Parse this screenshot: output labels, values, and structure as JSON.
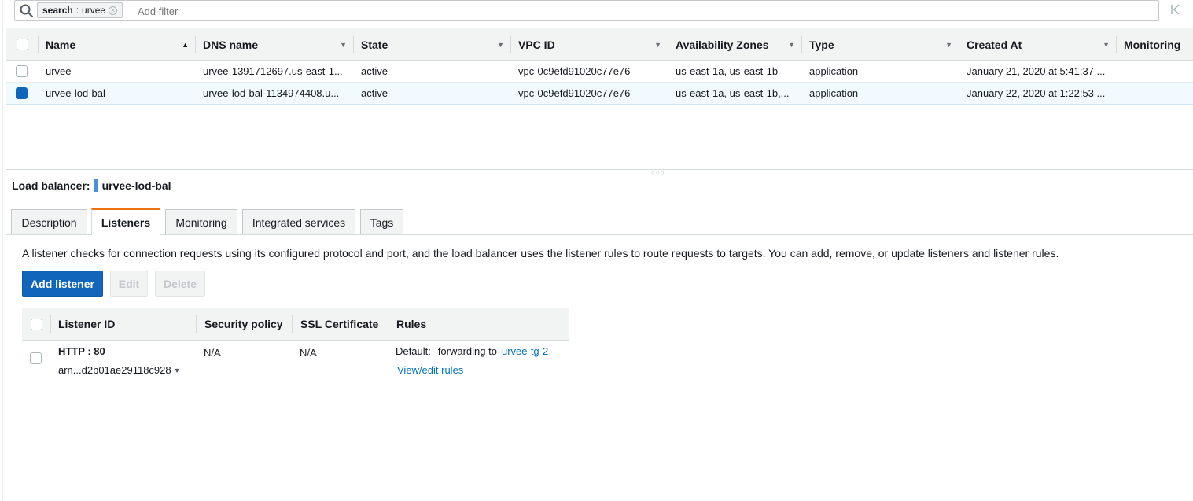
{
  "filter": {
    "token_key": "search",
    "token_sep": " : ",
    "token_value": "urvee",
    "placeholder": "Add filter"
  },
  "grid": {
    "columns": [
      {
        "label": "Name",
        "sort": "asc"
      },
      {
        "label": "DNS name"
      },
      {
        "label": "State"
      },
      {
        "label": "VPC ID"
      },
      {
        "label": "Availability Zones"
      },
      {
        "label": "Type"
      },
      {
        "label": "Created At"
      },
      {
        "label": "Monitoring"
      }
    ],
    "rows": [
      {
        "selected": false,
        "name": "urvee",
        "dns": "urvee-1391712697.us-east-1...",
        "state": "active",
        "vpc": "vpc-0c9efd91020c77e76",
        "az": "us-east-1a, us-east-1b",
        "type": "application",
        "created": "January 21, 2020 at 5:41:37 ..."
      },
      {
        "selected": true,
        "name": "urvee-lod-bal",
        "dns": "urvee-lod-bal-1134974408.u...",
        "state": "active",
        "vpc": "vpc-0c9efd91020c77e76",
        "az": "us-east-1a, us-east-1b,...",
        "type": "application",
        "created": "January 22, 2020 at 1:22:53 ..."
      }
    ]
  },
  "detail": {
    "label": "Load balancer:",
    "name": "urvee-lod-bal",
    "tabs": [
      "Description",
      "Listeners",
      "Monitoring",
      "Integrated services",
      "Tags"
    ],
    "active_tab": "Listeners",
    "description": "A listener checks for connection requests using its configured protocol and port, and the load balancer uses the listener rules to route requests to targets. You can add, remove, or update listeners and listener rules.",
    "buttons": {
      "add": "Add listener",
      "edit": "Edit",
      "delete": "Delete"
    },
    "listeners": {
      "columns": [
        "Listener ID",
        "Security policy",
        "SSL Certificate",
        "Rules"
      ],
      "rows": [
        {
          "id": "HTTP : 80",
          "arn": "arn...d2b01ae29118c928",
          "security_policy": "N/A",
          "ssl_certificate": "N/A",
          "rule_prefix": "Default:",
          "rule_action": "forwarding to",
          "rule_target": "urvee-tg-2",
          "rule_link": "View/edit rules"
        }
      ]
    }
  },
  "colors": {
    "primary": "#1166bb",
    "tab_accent": "#ec7211",
    "link": "#0073bb",
    "selected_row": "#f1faff"
  }
}
